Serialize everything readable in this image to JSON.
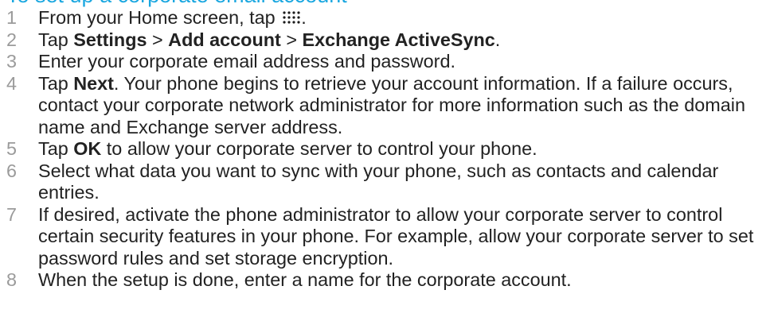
{
  "colors": {
    "heading": "#1aa7e0",
    "text": "#222222",
    "number": "#9b9b9b"
  },
  "heading": "To set up a corporate email account",
  "steps": [
    {
      "num": "1",
      "parts": [
        "From your Home screen, tap ",
        "."
      ],
      "icon": "apps-grid-icon"
    },
    {
      "num": "2",
      "parts": [
        "Tap ",
        "Settings",
        " > ",
        "Add account",
        " > ",
        "Exchange ActiveSync",
        "."
      ]
    },
    {
      "num": "3",
      "text": "Enter your corporate email address and password."
    },
    {
      "num": "4",
      "parts": [
        "Tap ",
        "Next",
        ". Your phone begins to retrieve your account information. If a failure occurs, contact your corporate network administrator for more information such as the domain name and Exchange server address."
      ]
    },
    {
      "num": "5",
      "parts": [
        "Tap ",
        "OK",
        " to allow your corporate server to control your phone."
      ]
    },
    {
      "num": "6",
      "text": "Select what data you want to sync with your phone, such as contacts and calendar entries."
    },
    {
      "num": "7",
      "text": "If desired, activate the phone administrator to allow your corporate server to control certain security features in your phone. For example, allow your corporate server to set password rules and set storage encryption."
    },
    {
      "num": "8",
      "text": "When the setup is done, enter a name for the corporate account."
    }
  ]
}
